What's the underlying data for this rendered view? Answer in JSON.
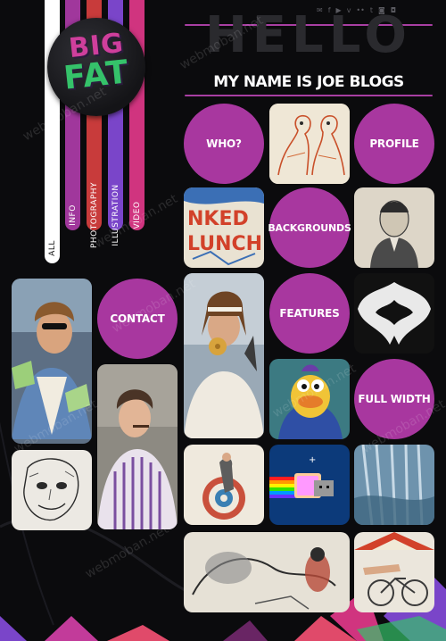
{
  "social_icons": [
    "twitter-icon",
    "facebook-icon",
    "play-icon",
    "vimeo-icon",
    "flickr-icon",
    "tumblr-icon",
    "camera-icon",
    "rss-icon"
  ],
  "social_glyphs": [
    "✉",
    "f",
    "▶",
    "v",
    "••",
    "t",
    "◙",
    "◘"
  ],
  "logo": {
    "line1": "BIG",
    "line2": "FAT"
  },
  "nav": [
    {
      "label": "ALL",
      "color": "#ffffff",
      "text_color": "#111111"
    },
    {
      "label": "INFO",
      "color": "#a0379c"
    },
    {
      "label": "PHOTOGRAPHY",
      "color": "#c83b3b"
    },
    {
      "label": "ILLUSTRATION",
      "color": "#7a45c9"
    },
    {
      "label": "VIDEO",
      "color": "#d0347f"
    }
  ],
  "heading": {
    "ghost": "HELLO",
    "title": "MY NAME IS JOE BLOGS"
  },
  "circles": {
    "who": "WHO?",
    "profile": "PROFILE",
    "backgrounds": "BACKGROUNDS",
    "contact": "CONTACT",
    "features": "FEATURES",
    "full_width": "FULL WIDTH"
  },
  "watermark": "webmoban.net",
  "colors": {
    "accent": "#a8379f",
    "background": "#0b0b0d"
  }
}
